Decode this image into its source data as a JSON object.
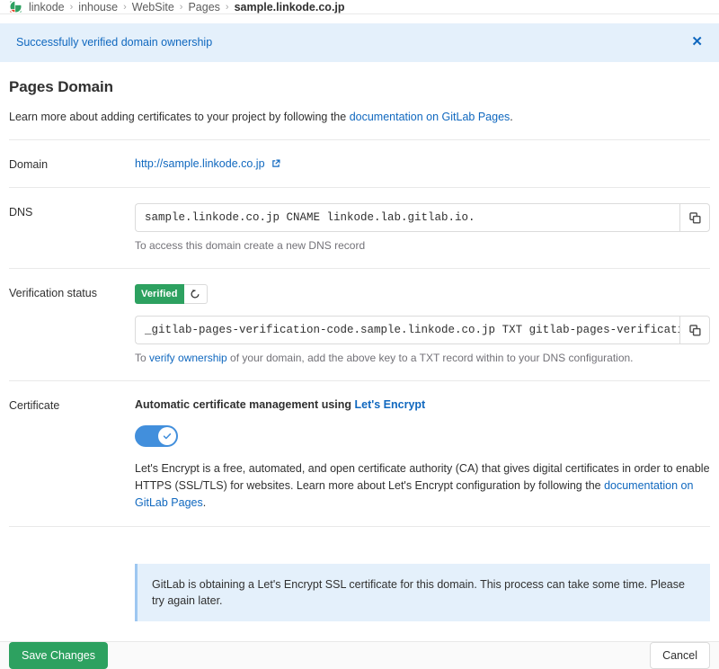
{
  "breadcrumb": {
    "icon": "project-avatar-icon",
    "separator": "›",
    "items": [
      {
        "label": "linkode"
      },
      {
        "label": "inhouse"
      },
      {
        "label": "WebSite"
      },
      {
        "label": "Pages"
      },
      {
        "label": "sample.linkode.co.jp"
      }
    ]
  },
  "alert": {
    "message": "Successfully verified domain ownership",
    "close_label": "✕",
    "background": "#e4f0fb",
    "text_color": "#1068bf"
  },
  "page": {
    "title": "Pages Domain",
    "lead_prefix": "Learn more about adding certificates to your project by following the ",
    "lead_link": "documentation on GitLab Pages",
    "lead_suffix": "."
  },
  "domain_row": {
    "label": "Domain",
    "url_text": "http://sample.linkode.co.jp",
    "external_icon": "external-link-icon"
  },
  "dns_row": {
    "label": "DNS",
    "value": "sample.linkode.co.jp CNAME linkode.lab.gitlab.io.",
    "copy_icon": "copy-icon",
    "help": "To access this domain create a new DNS record"
  },
  "verification_row": {
    "label": "Verification status",
    "badge": "Verified",
    "badge_color": "#2da160",
    "retry_icon": "retry-icon",
    "value": "_gitlab-pages-verification-code.sample.linkode.co.jp TXT gitlab-pages-verification-code=",
    "copy_icon": "copy-icon",
    "help_prefix": "To ",
    "help_link": "verify ownership",
    "help_suffix": " of your domain, add the above key to a TXT record within to your DNS configuration."
  },
  "certificate_row": {
    "label": "Certificate",
    "title_prefix": "Automatic certificate management using ",
    "title_link": "Let's Encrypt",
    "toggle_state": "on",
    "toggle_color": "#428fdc",
    "description_prefix": "Let's Encrypt is a free, automated, and open certificate authority (CA) that gives digital certificates in order to enable HTTPS (SSL/TLS) for websites. Learn more about Let's Encrypt configuration by following the ",
    "description_link": "documentation on GitLab Pages",
    "description_suffix": "."
  },
  "info_banner": {
    "message": "GitLab is obtaining a Let's Encrypt SSL certificate for this domain. This process can take some time. Please try again later."
  },
  "footer": {
    "save_label": "Save Changes",
    "cancel_label": "Cancel",
    "save_color": "#2da160"
  }
}
